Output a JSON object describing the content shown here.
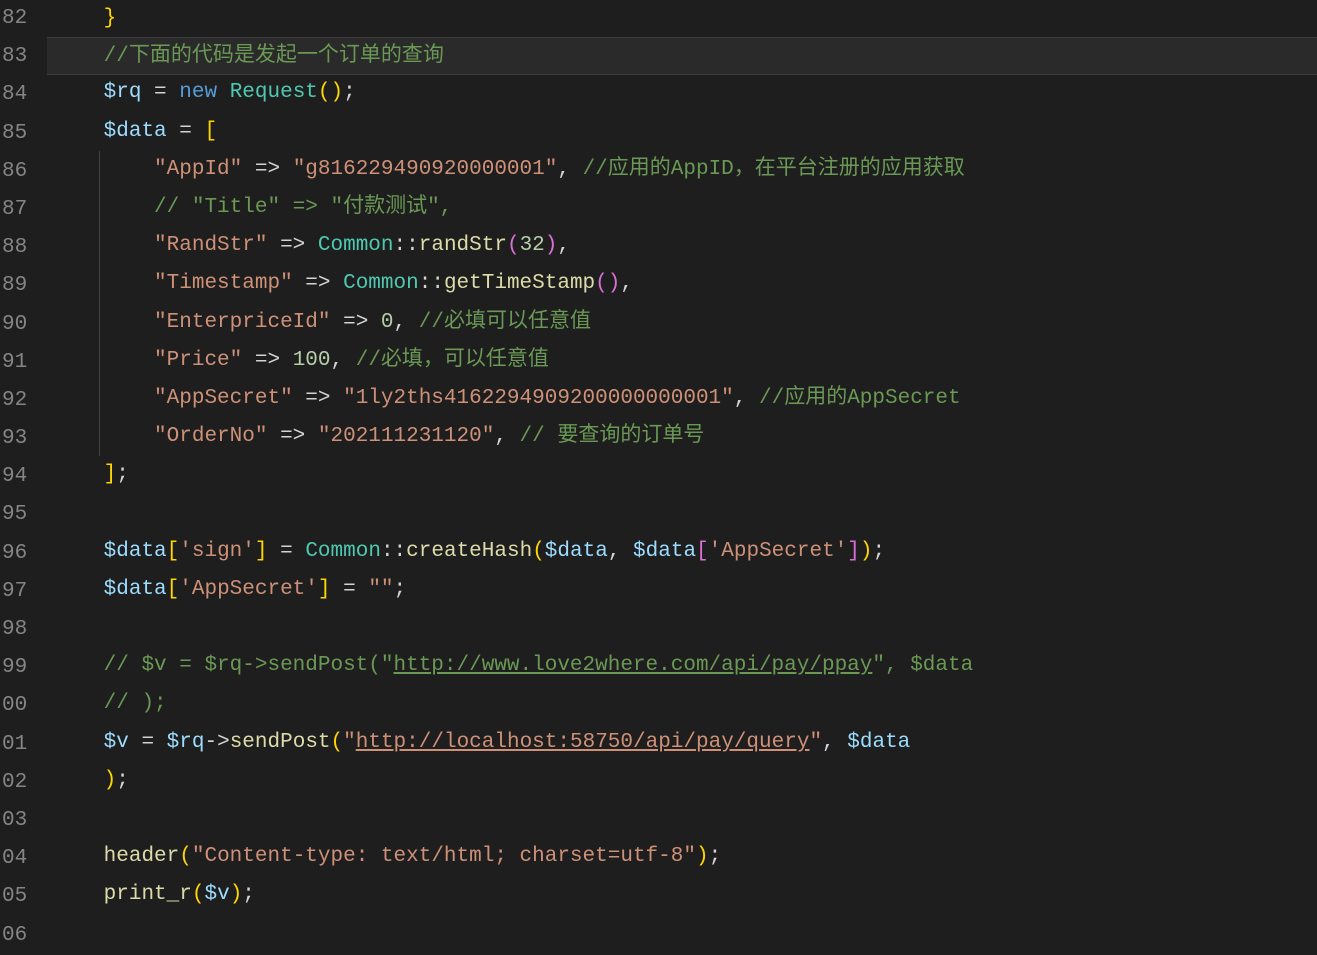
{
  "lineNumbers": [
    "82",
    "83",
    "84",
    "85",
    "86",
    "87",
    "88",
    "89",
    "90",
    "91",
    "92",
    "93",
    "94",
    "95",
    "96",
    "97",
    "98",
    "99",
    "00",
    "01",
    "02",
    "03",
    "04",
    "05",
    "06"
  ],
  "tokens": {
    "bracket82": "}",
    "comment83": "//下面的代码是发起一个订单的查询",
    "rq": "$rq",
    "eq": " = ",
    "new": "new",
    "sp": " ",
    "Request": "Request",
    "parenOpen": "(",
    "parenClose": ")",
    "semi": ";",
    "data": "$data",
    "bracketOpen": "[",
    "bracketClose": "]",
    "appIdKey": "\"AppId\"",
    "arrow": " => ",
    "appIdVal": "\"g816229490920000001\"",
    "comma": ", ",
    "commentAppId": "//应用的AppID，在平台注册的应用获取",
    "commentTitle": "// \"Title\" => \"付款测试\",",
    "randStrKey": "\"RandStr\"",
    "Common": "Common",
    "dcolon": "::",
    "randStr": "randStr",
    "n32": "32",
    "commaOnly": ",",
    "timestampKey": "\"Timestamp\"",
    "getTimeStamp": "getTimeStamp",
    "enterpriceKey": "\"EnterpriceId\"",
    "n0": "0",
    "commentEnterprice": "//必填可以任意值",
    "priceKey": "\"Price\"",
    "n100": "100",
    "commentPrice": "//必填，可以任意值",
    "appSecretKey": "\"AppSecret\"",
    "appSecretVal": "\"1ly2ths4162294909200000000001\"",
    "commentAppSecret": "//应用的AppSecret",
    "orderNoKey": "\"OrderNo\"",
    "orderNoVal": "\"202111231120\"",
    "commentOrderNo": "// 要查询的订单号",
    "signKey": "'sign'",
    "createHash": "createHash",
    "appSecretKey2": "'AppSecret'",
    "emptyStr": "\"\"",
    "comment99a": "// $v = $rq->sendPost(\"",
    "comment99url": "http://www.love2where.com/api/pay/ppay",
    "comment99b": "\", $data",
    "comment00": "// );",
    "v": "$v",
    "sendPost": "sendPost",
    "arrow2": "->",
    "url01a": "\"",
    "url01": "http://localhost:58750/api/pay/query",
    "url01b": "\"",
    "header": "header",
    "headerStr": "\"Content-type: text/html; charset=utf-8\"",
    "print_r": "print_r"
  }
}
